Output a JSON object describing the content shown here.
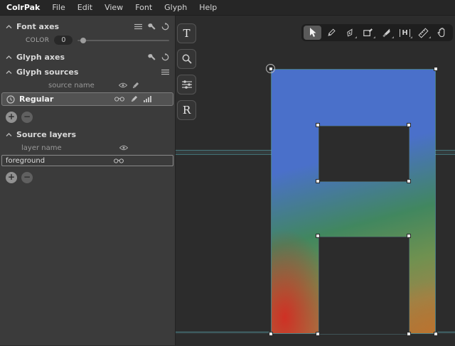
{
  "menu": {
    "app_title": "ColrPak",
    "items": [
      "File",
      "Edit",
      "View",
      "Font",
      "Glyph",
      "Help"
    ]
  },
  "sidebar": {
    "font_axes": {
      "title": "Font axes"
    },
    "color_axis": {
      "label": "COLOR",
      "value": "0"
    },
    "glyph_axes": {
      "title": "Glyph axes"
    },
    "glyph_sources": {
      "title": "Glyph sources",
      "column_header": "source name",
      "rows": [
        {
          "name": "Regular"
        }
      ]
    },
    "source_layers": {
      "title": "Source layers",
      "column_header": "layer name",
      "rows": [
        {
          "name": "foreground"
        }
      ]
    },
    "add_button": "+",
    "remove_button": "−"
  },
  "tools": {
    "text_tab": "T",
    "glyph_tab": "R",
    "metrics_letter": "H"
  },
  "colors": {
    "accent_guide": "#5fc4cf",
    "glyph_blue": "#4a70ca",
    "glyph_green": "#41875f",
    "glyph_red": "#d22d23",
    "glyph_orange": "#be732d",
    "selection_handle": "#e6e6e6"
  }
}
